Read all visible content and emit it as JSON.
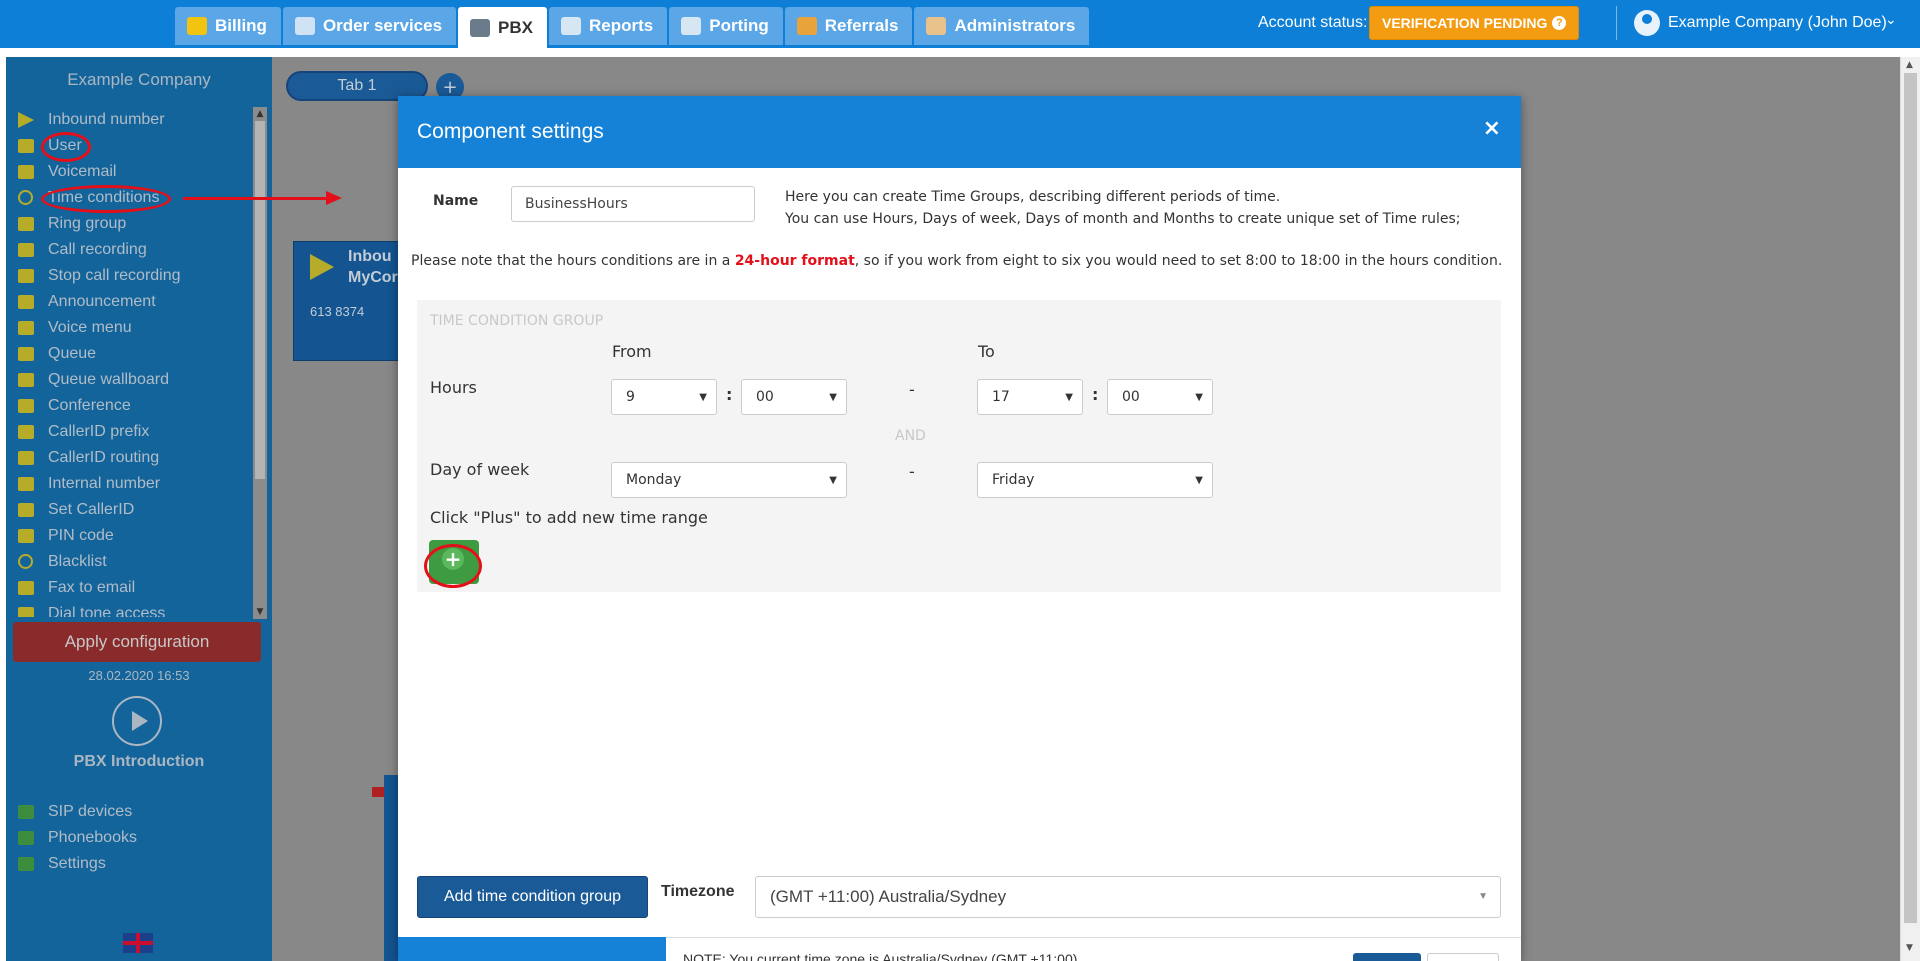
{
  "nav": {
    "tabs": [
      {
        "label": "Billing",
        "icon": "coins-icon"
      },
      {
        "label": "Order services",
        "icon": "cart-icon"
      },
      {
        "label": "PBX",
        "icon": "pbx-icon"
      },
      {
        "label": "Reports",
        "icon": "report-icon"
      },
      {
        "label": "Porting",
        "icon": "phone-icon"
      },
      {
        "label": "Referrals",
        "icon": "person-icon"
      },
      {
        "label": "Administrators",
        "icon": "admin-icon"
      }
    ],
    "active_tab": "PBX",
    "account_status_label": "Account status:",
    "account_status_badge": "VERIFICATION PENDING",
    "user_name": "Example Company (John Doe)"
  },
  "sidebar": {
    "company": "Example Company",
    "items": [
      {
        "label": "Inbound number"
      },
      {
        "label": "User"
      },
      {
        "label": "Voicemail"
      },
      {
        "label": "Time conditions"
      },
      {
        "label": "Ring group"
      },
      {
        "label": "Call recording"
      },
      {
        "label": "Stop call recording"
      },
      {
        "label": "Announcement"
      },
      {
        "label": "Voice menu"
      },
      {
        "label": "Queue"
      },
      {
        "label": "Queue wallboard"
      },
      {
        "label": "Conference"
      },
      {
        "label": "CallerID prefix"
      },
      {
        "label": "CallerID routing"
      },
      {
        "label": "Internal number"
      },
      {
        "label": "Set CallerID"
      },
      {
        "label": "PIN code"
      },
      {
        "label": "Blacklist"
      },
      {
        "label": "Fax to email"
      },
      {
        "label": "Dial tone access"
      }
    ],
    "apply_label": "Apply configuration",
    "apply_date": "28.02.2020 16:53",
    "intro_label": "PBX Introduction",
    "bottom_items": [
      {
        "label": "SIP devices"
      },
      {
        "label": "Phonebooks"
      },
      {
        "label": "Settings"
      }
    ]
  },
  "canvas": {
    "tab1_label": "Tab 1",
    "card_line1": "Inbou",
    "card_line2": "MyCor",
    "card_phone": "613 8374"
  },
  "modal": {
    "title": "Component settings",
    "close": "×",
    "name_label": "Name",
    "name_value": "BusinessHours",
    "help_line1": "Here you can create Time Groups, describing different periods of time.",
    "help_line2": "You can use Hours, Days of week, Days of month and Months to create unique set of Time rules;",
    "note_before": "Please note that the hours conditions are in a ",
    "note_highlight": "24-hour format",
    "note_after": ", so if you work from eight to six you would need to set 8:00 to 18:00 in the hours condition.",
    "group_title": "TIME CONDITION GROUP",
    "from_label": "From",
    "to_label": "To",
    "hours_label": "Hours",
    "hours_from_h": "9",
    "hours_from_m": "00",
    "hours_to_h": "17",
    "hours_to_m": "00",
    "colon": ":",
    "dash": "-",
    "and_label": "AND",
    "dow_label": "Day of week",
    "dow_from": "Monday",
    "dow_to": "Friday",
    "plus_hint": "Click \"Plus\" to add new time range",
    "add_group_label": "Add time condition group",
    "timezone_label": "Timezone",
    "timezone_value": "(GMT +11:00) Australia/Sydney",
    "footer_text": "NOTE: You current time zone is Australia/Sydney (GMT +11:00)"
  },
  "colors": {
    "nav_blue": "#0d7fd6",
    "sidebar_blue": "#14649c",
    "modal_header": "#1582d8",
    "badge_orange": "#f39c12",
    "annotation_red": "#e3101a",
    "plus_green": "#3f9b41"
  }
}
